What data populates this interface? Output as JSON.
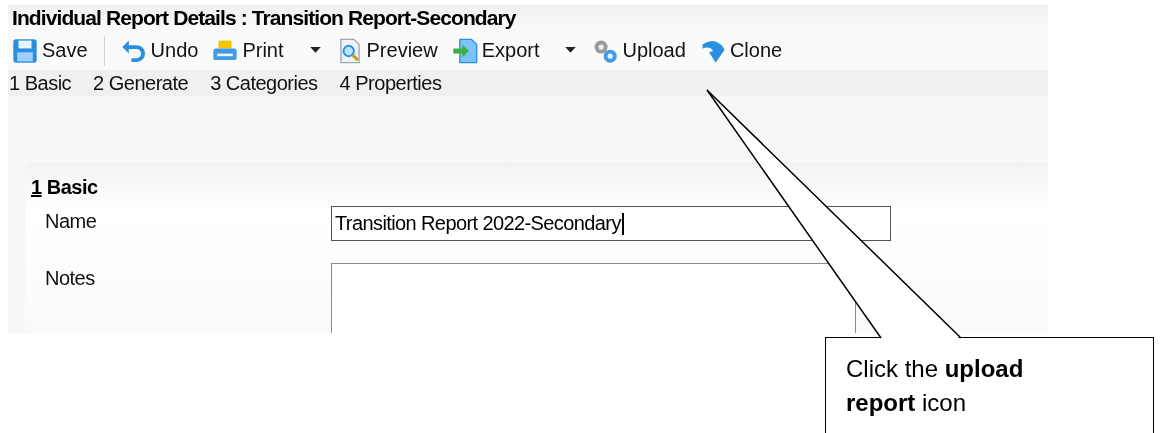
{
  "window": {
    "title": "Individual Report Details : Transition Report-Secondary"
  },
  "toolbar": [
    {
      "kind": "save",
      "label": "Save",
      "dropdown": false
    },
    {
      "kind": "separator"
    },
    {
      "kind": "undo",
      "label": "Undo",
      "dropdown": false
    },
    {
      "kind": "print",
      "label": "Print",
      "dropdown": true
    },
    {
      "kind": "preview",
      "label": "Preview",
      "dropdown": false
    },
    {
      "kind": "export",
      "label": "Export",
      "dropdown": true
    },
    {
      "kind": "upload",
      "label": "Upload",
      "dropdown": false
    },
    {
      "kind": "clone",
      "label": "Clone",
      "dropdown": false
    }
  ],
  "nav": [
    "1 Basic",
    "2 Generate",
    "3 Categories",
    "4 Properties"
  ],
  "section": {
    "number": "1",
    "title": "Basic"
  },
  "fields": [
    {
      "kind": "text",
      "label": "Name",
      "value": "Transition Report 2022-Secondary",
      "focused": true
    },
    {
      "kind": "textarea",
      "label": "Notes",
      "focused": false
    }
  ],
  "callout": {
    "text": "Click the **upload report** icon"
  }
}
